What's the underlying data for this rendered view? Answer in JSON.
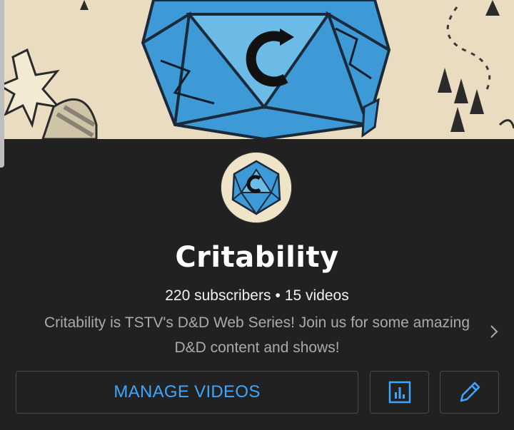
{
  "channel": {
    "name": "Critability",
    "subscribers": "220 subscribers",
    "separator": "•",
    "videos": "15 videos",
    "description": "Critability is TSTV's D&D Web Series! Join us for some amazing D&D content and shows!"
  },
  "actions": {
    "manage_videos_label": "MANAGE VIDEOS",
    "analytics_icon": "bar-chart-icon",
    "edit_icon": "pencil-icon"
  },
  "colors": {
    "background": "#212121",
    "accent": "#3ea6ff",
    "banner_bg": "#e9dcc0",
    "dice_blue": "#4aa3d8"
  }
}
